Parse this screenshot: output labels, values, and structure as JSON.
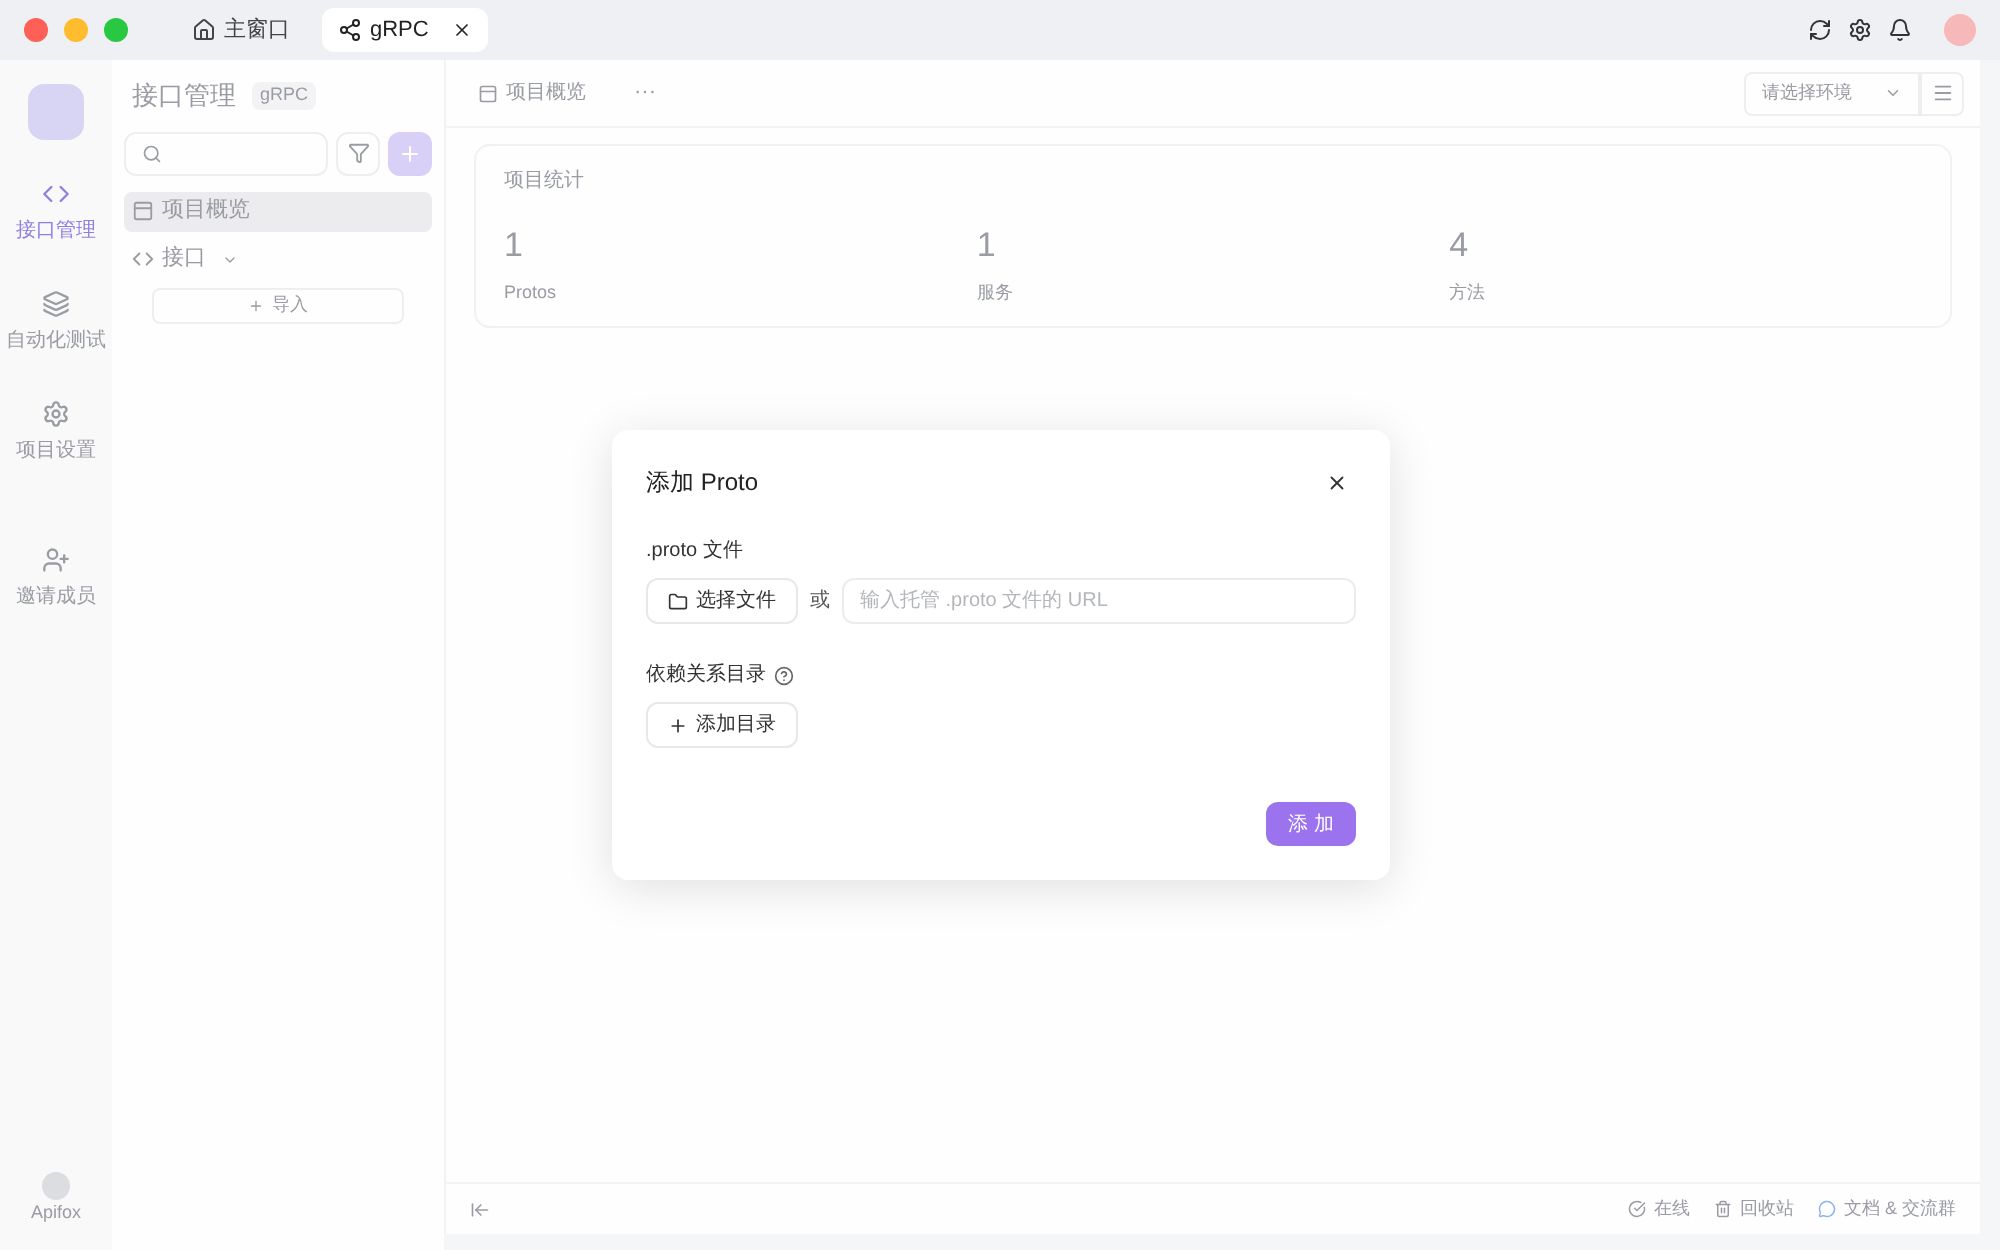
{
  "window_tabs": [
    {
      "label": "主窗口",
      "selected": false
    },
    {
      "label": "gRPC",
      "selected": true
    }
  ],
  "nav": [
    {
      "label": "接口管理",
      "selected": true
    },
    {
      "label": "自动化测试",
      "selected": false
    },
    {
      "label": "项目设置",
      "selected": false
    },
    {
      "label": "邀请成员",
      "selected": false
    }
  ],
  "brand": "Apifox",
  "sidebar": {
    "title": "接口管理",
    "badge": "gRPC",
    "items": [
      {
        "label": "项目概览",
        "selected": true
      },
      {
        "label": "接口",
        "selected": false,
        "expanded": true
      }
    ],
    "import_button": "导入"
  },
  "content_tab": {
    "label": "项目概览",
    "more": "···"
  },
  "env_select": {
    "placeholder": "请选择环境"
  },
  "stats": {
    "title": "项目统计",
    "items": [
      {
        "value": "1",
        "label": "Protos"
      },
      {
        "value": "1",
        "label": "服务"
      },
      {
        "value": "4",
        "label": "方法"
      }
    ]
  },
  "dialog": {
    "title": "添加 Proto",
    "proto_label": ".proto 文件",
    "choose_button": "选择文件",
    "or": "或",
    "url_placeholder": "输入托管 .proto 文件的 URL",
    "deps_label": "依赖关系目录",
    "add_dir_button": "添加目录",
    "submit": "添 加"
  },
  "status_bar": [
    {
      "label": "在线"
    },
    {
      "label": "回收站"
    },
    {
      "label": "文档 & 交流群"
    }
  ]
}
